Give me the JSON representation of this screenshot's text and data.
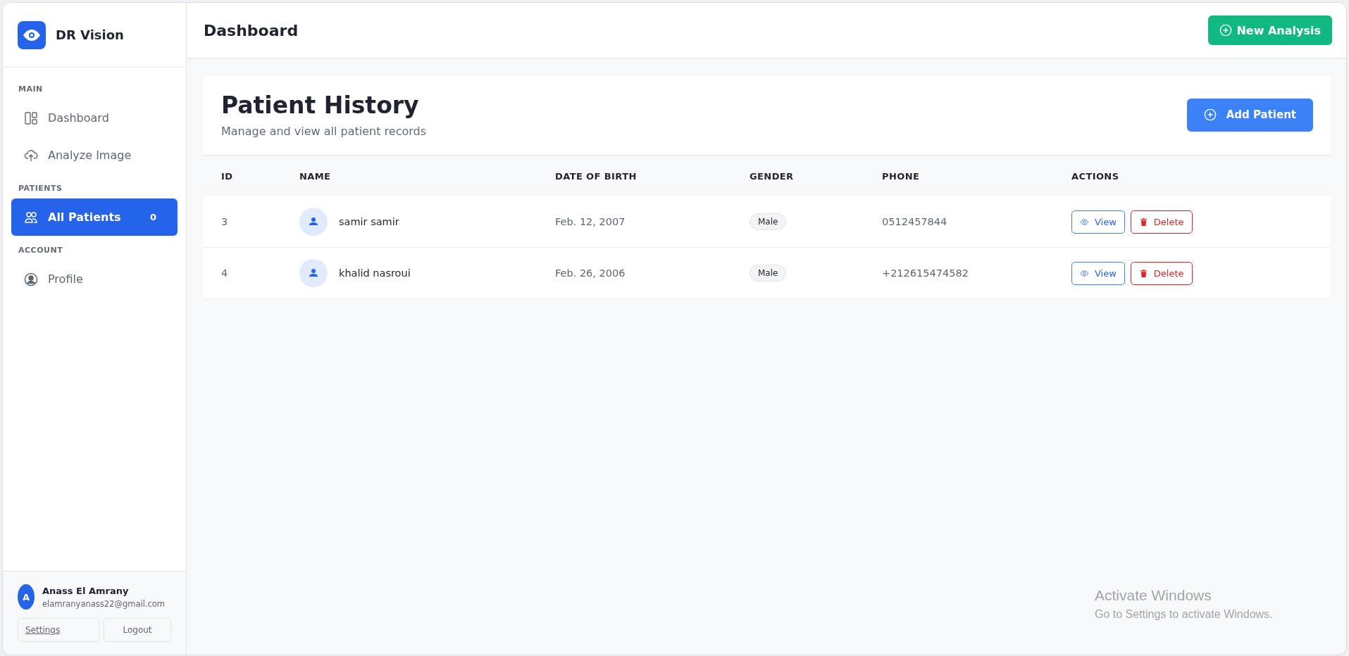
{
  "brand": {
    "name": "DR Vision"
  },
  "sidebar": {
    "sections": [
      {
        "title": "MAIN",
        "items": [
          {
            "label": "Dashboard",
            "selected": false
          },
          {
            "label": "Analyze Image",
            "selected": false
          }
        ]
      },
      {
        "title": "PATIENTS",
        "items": [
          {
            "label": "All Patients",
            "selected": true,
            "badge": "0"
          }
        ]
      },
      {
        "title": "ACCOUNT",
        "items": [
          {
            "label": "Profile",
            "selected": false
          }
        ]
      }
    ]
  },
  "user": {
    "initial": "A",
    "name": "Anass El Amrany",
    "email": "elamranyanass22@gmail.com",
    "settings_link": "Settings",
    "logout_button": "Logout"
  },
  "header": {
    "title": "Dashboard",
    "new_analysis_button": "New Analysis"
  },
  "page": {
    "title": "Patient History",
    "subtitle": "Manage and view all patient records",
    "add_button": "Add Patient"
  },
  "table": {
    "columns": [
      "ID",
      "NAME",
      "DATE OF BIRTH",
      "GENDER",
      "PHONE",
      "ACTIONS"
    ],
    "rows": [
      {
        "id": "3",
        "name": "samir samir",
        "dob": "Feb. 12, 2007",
        "gender": "Male",
        "phone": "0512457844",
        "view": "View",
        "delete": "Delete"
      },
      {
        "id": "4",
        "name": "khalid nasroui",
        "dob": "Feb. 26, 2006",
        "gender": "Male",
        "phone": "+212615474582",
        "view": "View",
        "delete": "Delete"
      }
    ]
  },
  "os_notice": {
    "title": "Activate Windows",
    "message": "Go to Settings to activate Windows."
  }
}
